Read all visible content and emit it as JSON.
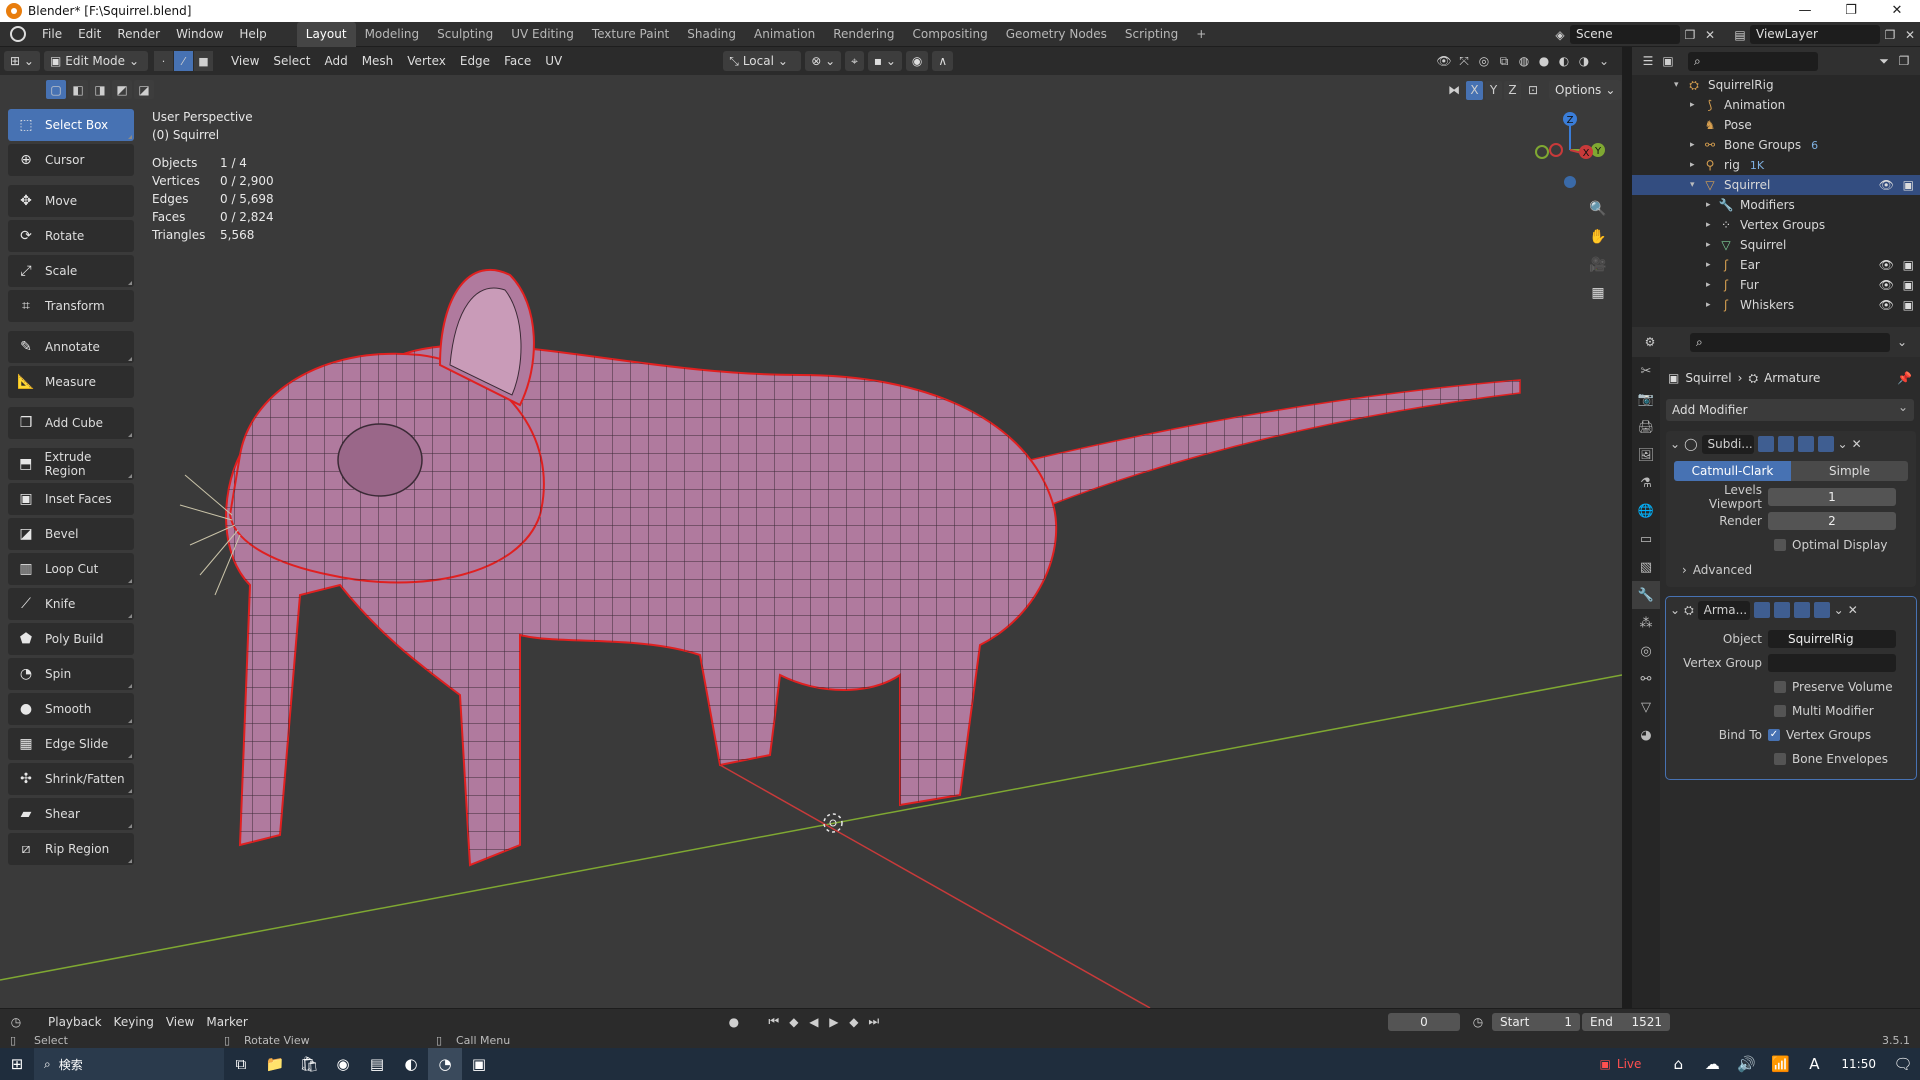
{
  "window": {
    "title": "Blender* [F:\\Squirrel.blend]"
  },
  "menubar": {
    "menus": [
      "File",
      "Edit",
      "Render",
      "Window",
      "Help"
    ],
    "workspaces": [
      "Layout",
      "Modeling",
      "Sculpting",
      "UV Editing",
      "Texture Paint",
      "Shading",
      "Animation",
      "Rendering",
      "Compositing",
      "Geometry Nodes",
      "Scripting"
    ],
    "active_workspace": "Layout",
    "scene": "Scene",
    "view_layer": "ViewLayer"
  },
  "viewport_header": {
    "mode": "Edit Mode",
    "menus": [
      "View",
      "Select",
      "Add",
      "Mesh",
      "Vertex",
      "Edge",
      "Face",
      "UV"
    ],
    "transform_orientation": "Local",
    "options_label": "Options",
    "axes": [
      "X",
      "Y",
      "Z"
    ]
  },
  "toolbar": {
    "tools": [
      "Select Box",
      "Cursor",
      "Move",
      "Rotate",
      "Scale",
      "Transform",
      "Annotate",
      "Measure",
      "Add Cube",
      "Extrude Region",
      "Inset Faces",
      "Bevel",
      "Loop Cut",
      "Knife",
      "Poly Build",
      "Spin",
      "Smooth",
      "Edge Slide",
      "Shrink/Fatten",
      "Shear",
      "Rip Region"
    ],
    "active": "Select Box"
  },
  "viewport_info": {
    "view_name": "User Perspective",
    "object_name": "(0) Squirrel",
    "stats": [
      {
        "label": "Objects",
        "value": "1 / 4"
      },
      {
        "label": "Vertices",
        "value": "0 / 2,900"
      },
      {
        "label": "Edges",
        "value": "0 / 5,698"
      },
      {
        "label": "Faces",
        "value": "0 / 2,824"
      },
      {
        "label": "Triangles",
        "value": "5,568"
      }
    ]
  },
  "gizmo": {
    "x": "X",
    "y": "Y",
    "z": "Z"
  },
  "outliner": {
    "items": [
      {
        "name": "SquirrelRig",
        "indent": 1
      },
      {
        "name": "Animation",
        "indent": 2
      },
      {
        "name": "Pose",
        "indent": 2
      },
      {
        "name": "Bone Groups",
        "indent": 2,
        "extra": "6"
      },
      {
        "name": "rig",
        "indent": 2,
        "extra": "1K"
      },
      {
        "name": "Squirrel",
        "indent": 2,
        "selected": true
      },
      {
        "name": "Modifiers",
        "indent": 3
      },
      {
        "name": "Vertex Groups",
        "indent": 3
      },
      {
        "name": "Squirrel",
        "indent": 3
      },
      {
        "name": "Ear",
        "indent": 3
      },
      {
        "name": "Fur",
        "indent": 3
      },
      {
        "name": "Whiskers",
        "indent": 3
      }
    ]
  },
  "properties": {
    "breadcrumb_object": "Squirrel",
    "breadcrumb_modifier": "Armature",
    "add_modifier": "Add Modifier",
    "subdiv": {
      "name": "Subdi...",
      "mode_catmull": "Catmull-Clark",
      "mode_simple": "Simple",
      "levels_viewport_label": "Levels Viewport",
      "levels_viewport": "1",
      "render_label": "Render",
      "render": "2",
      "optimal_display": "Optimal Display",
      "advanced": "Advanced"
    },
    "armature": {
      "name": "Arma...",
      "object_label": "Object",
      "object_value": "SquirrelRig",
      "vertex_group_label": "Vertex Group",
      "preserve_volume": "Preserve Volume",
      "multi_modifier": "Multi Modifier",
      "bind_to_label": "Bind To",
      "vertex_groups": "Vertex Groups",
      "bone_envelopes": "Bone Envelopes"
    }
  },
  "timeline": {
    "menus": [
      "Playback",
      "Keying",
      "View",
      "Marker"
    ],
    "current_frame": "0",
    "start_label": "Start",
    "start": "1",
    "end_label": "End",
    "end": "1521"
  },
  "statusbar": {
    "left": "Select",
    "middle": "Rotate View",
    "right": "Call Menu",
    "version": "3.5.1"
  },
  "taskbar": {
    "search": "検索",
    "live": "Live",
    "time": "11:50"
  },
  "colors": {
    "accent": "#4772b3",
    "mesh": "#b07a9e",
    "seam": "#e02020",
    "x_axis": "#c83a3a",
    "y_axis": "#7fa832"
  }
}
